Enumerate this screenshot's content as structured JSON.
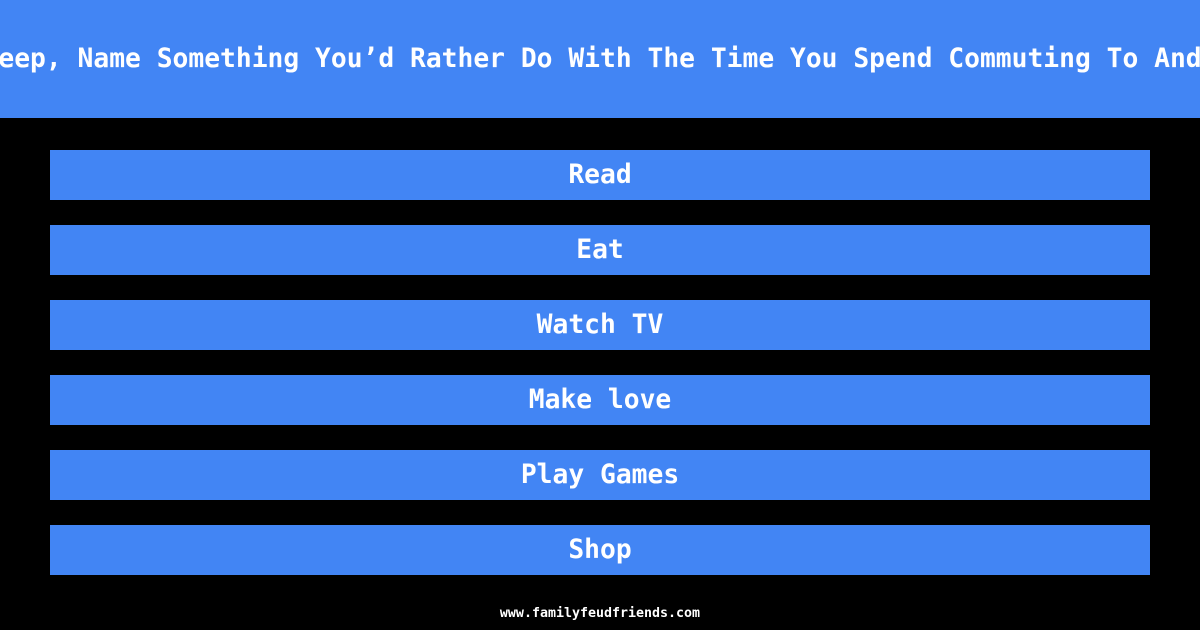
{
  "colors": {
    "background": "#000000",
    "bar": "#4285f4",
    "text": "#ffffff"
  },
  "header": {
    "question": "Besides Sleep, Name Something You’d Rather Do With The Time You Spend Commuting To And From Work",
    "visible_fragment": "eep, Name Something You’d Rather Do With The Time You Spend Commuting To And"
  },
  "answers": [
    {
      "rank": 1,
      "label": "Read"
    },
    {
      "rank": 2,
      "label": "Eat"
    },
    {
      "rank": 3,
      "label": "Watch TV"
    },
    {
      "rank": 4,
      "label": "Make love"
    },
    {
      "rank": 5,
      "label": "Play Games"
    },
    {
      "rank": 6,
      "label": "Shop"
    }
  ],
  "footer": {
    "site": "www.familyfeudfriends.com"
  }
}
